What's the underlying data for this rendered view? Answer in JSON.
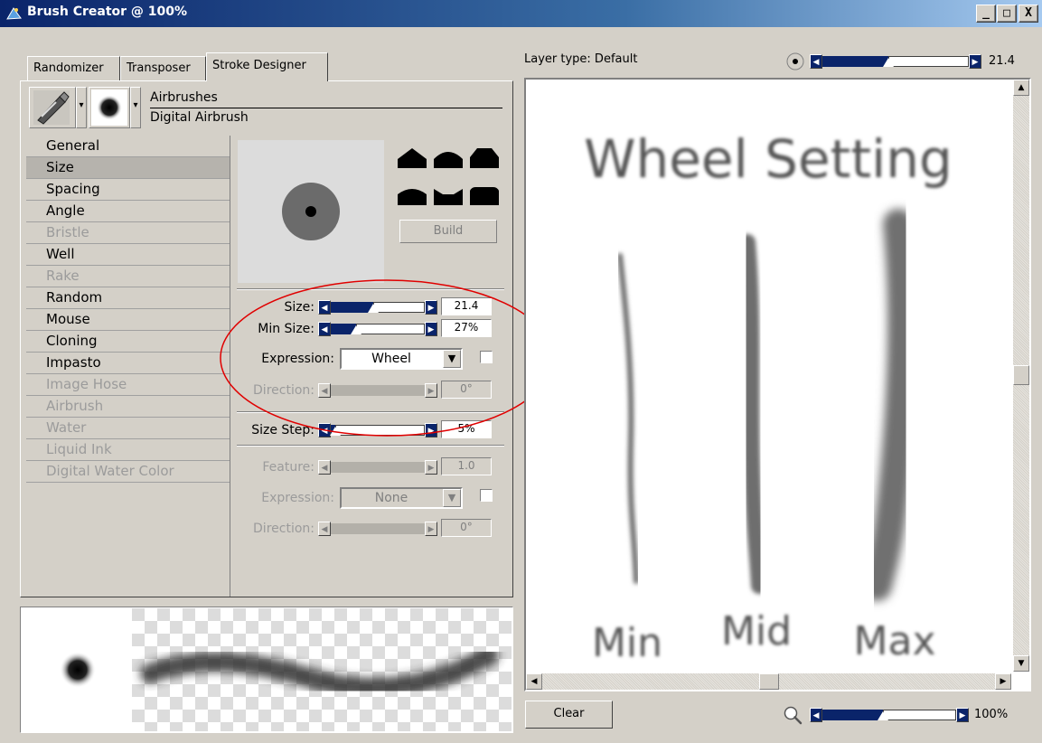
{
  "window": {
    "title": "Brush Creator @ 100%",
    "minimize": "_",
    "maximize": "□",
    "close": "X"
  },
  "tabs": [
    "Randomizer",
    "Transposer",
    "Stroke Designer"
  ],
  "active_tab": "Stroke Designer",
  "brush": {
    "category": "Airbrushes",
    "variant": "Digital Airbrush"
  },
  "categories": [
    {
      "label": "General",
      "enabled": true
    },
    {
      "label": "Size",
      "enabled": true,
      "selected": true
    },
    {
      "label": "Spacing",
      "enabled": true
    },
    {
      "label": "Angle",
      "enabled": true
    },
    {
      "label": "Bristle",
      "enabled": false
    },
    {
      "label": "Well",
      "enabled": true
    },
    {
      "label": "Rake",
      "enabled": false
    },
    {
      "label": "Random",
      "enabled": true
    },
    {
      "label": "Mouse",
      "enabled": true
    },
    {
      "label": "Cloning",
      "enabled": true
    },
    {
      "label": "Impasto",
      "enabled": true
    },
    {
      "label": "Image Hose",
      "enabled": false
    },
    {
      "label": "Airbrush",
      "enabled": false
    },
    {
      "label": "Water",
      "enabled": false
    },
    {
      "label": "Liquid Ink",
      "enabled": false
    },
    {
      "label": "Digital Water Color",
      "enabled": false
    }
  ],
  "build_button": "Build",
  "size_controls": {
    "size_label": "Size:",
    "size_value": "21.4",
    "size_level": 0.45,
    "min_size_label": "Min Size:",
    "min_size_value": "27%",
    "min_size_level": 0.27,
    "expression_label": "Expression:",
    "expression_value": "Wheel",
    "direction_label": "Direction:",
    "direction_value": "0°",
    "size_step_label": "Size Step:",
    "size_step_value": "5%",
    "size_step_level": 0.05
  },
  "feature_controls": {
    "feature_label": "Feature:",
    "feature_value": "1.0",
    "expression_label": "Expression:",
    "expression_value": "None",
    "direction_label": "Direction:",
    "direction_value": "0°"
  },
  "canvas": {
    "layer_type": "Layer type: Default",
    "brush_size_value": "21.4",
    "brush_size_level": 0.45,
    "clear_button": "Clear",
    "zoom_value": "100%",
    "zoom_level": 0.45,
    "text_top": "Wheel Setting",
    "label_min": "Min",
    "label_mid": "Mid",
    "label_max": "Max"
  },
  "annotation_color": "#e00000",
  "accent_color": "#0a246a"
}
